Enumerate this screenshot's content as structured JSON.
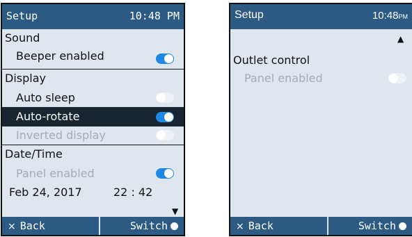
{
  "screen1": {
    "title": "Setup",
    "time": "10:48 PM",
    "sections": {
      "sound": "Sound",
      "display": "Display",
      "datetime": "Date/Time"
    },
    "items": {
      "beeper": "Beeper enabled",
      "auto_sleep": "Auto sleep",
      "auto_rotate": "Auto-rotate",
      "inverted": "Inverted display",
      "panel": "Panel enabled",
      "date": "Feb 24, 2017",
      "time_value": "22 : 42"
    },
    "toggles": {
      "beeper": "on",
      "auto_sleep": "off",
      "auto_rotate": "on",
      "inverted": "off",
      "panel": "on"
    },
    "scroll_indicator": "▼",
    "footer": {
      "back": "Back",
      "back_icon": "×",
      "switch": "Switch"
    }
  },
  "screen2": {
    "title": "Setup",
    "time": "10:48",
    "time_suffix": "PM",
    "scroll_indicator": "▲",
    "items": {
      "outlet": "Outlet control",
      "panel": "Panel enabled"
    },
    "toggles": {
      "panel": "off"
    },
    "footer": {
      "back": "Back",
      "back_icon": "×",
      "switch": "Switch"
    }
  },
  "colors": {
    "titlebar": "#2c5a82",
    "background": "#dfe6ee",
    "selected": "#1a2532",
    "toggle_on": "#1e88e5",
    "disabled_text": "#a4acb4"
  }
}
